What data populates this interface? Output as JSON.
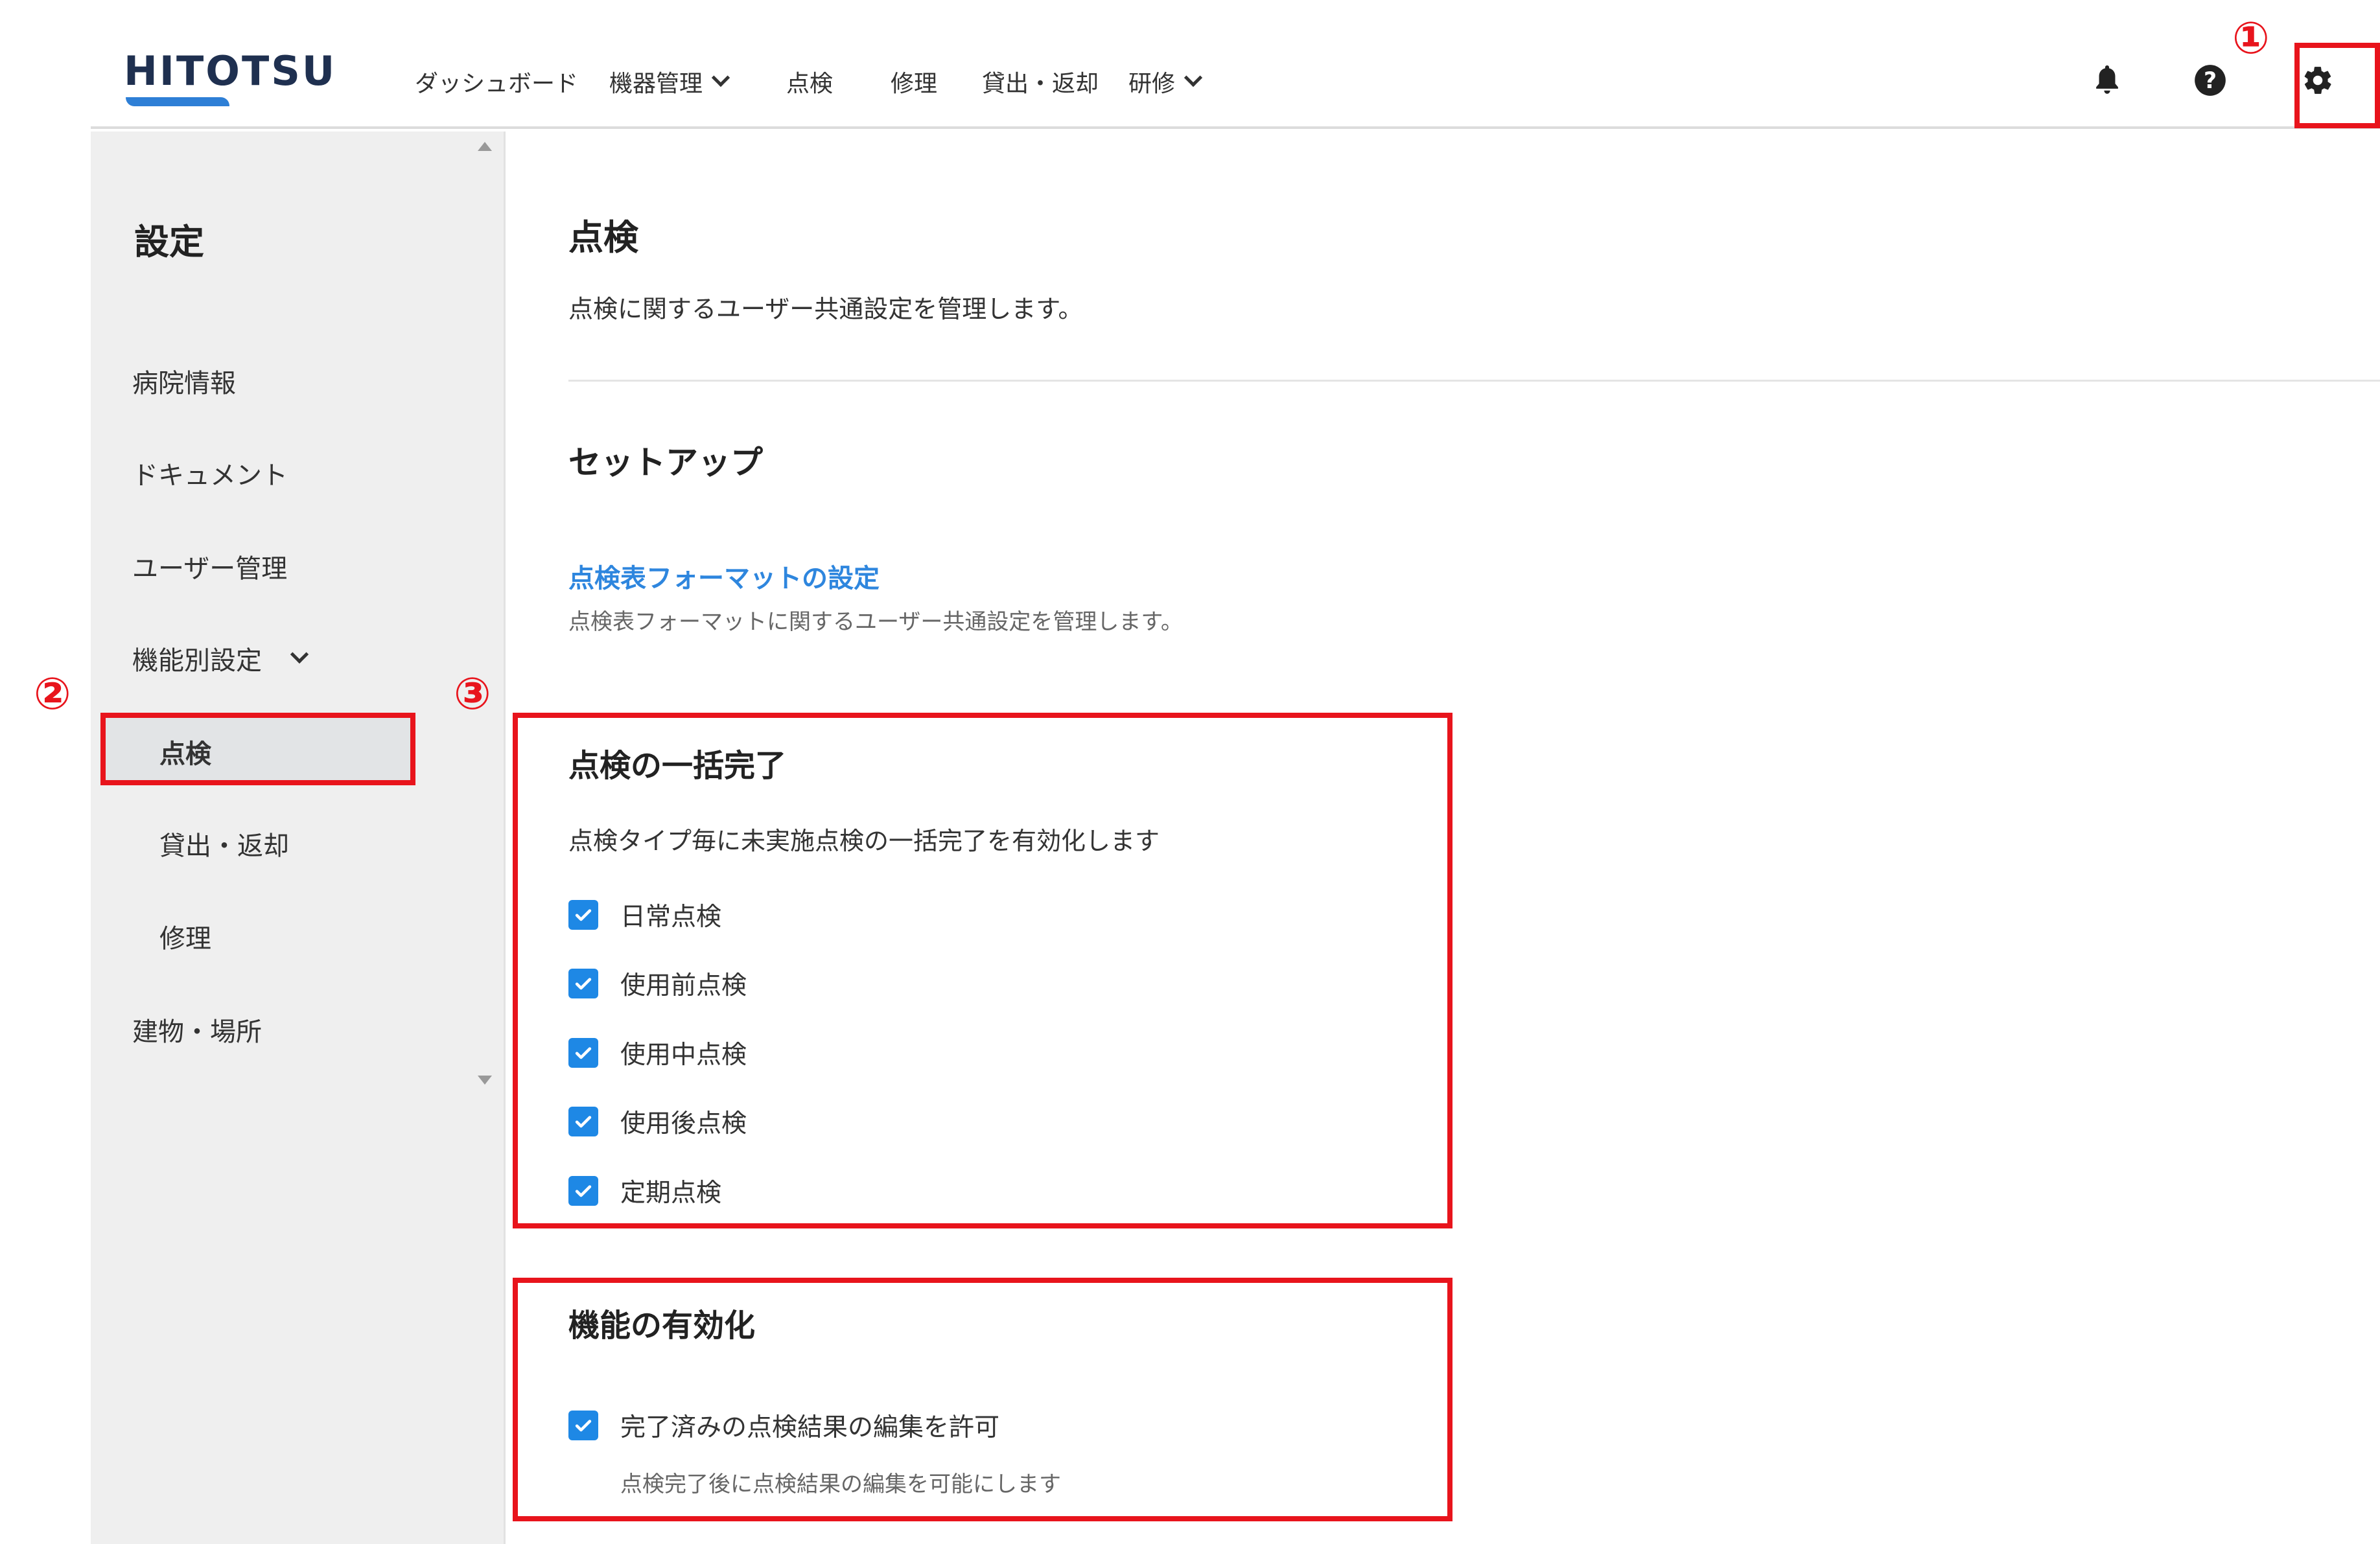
{
  "header": {
    "logo": "HITOTSU",
    "nav": [
      {
        "label": "ダッシュボード",
        "dropdown": false
      },
      {
        "label": "機器管理",
        "dropdown": true
      },
      {
        "label": "点検",
        "dropdown": false
      },
      {
        "label": "修理",
        "dropdown": false
      },
      {
        "label": "貸出・返却",
        "dropdown": false
      },
      {
        "label": "研修",
        "dropdown": true
      }
    ],
    "icons": [
      "bell-icon",
      "help-icon",
      "gear-icon"
    ]
  },
  "sidebar": {
    "title": "設定",
    "items": [
      {
        "label": "病院情報"
      },
      {
        "label": "ドキュメント"
      },
      {
        "label": "ユーザー管理"
      },
      {
        "label": "機能別設定",
        "expanded": true
      },
      {
        "label": "点検",
        "active": true
      },
      {
        "label": "貸出・返却"
      },
      {
        "label": "修理"
      },
      {
        "label": "建物・場所"
      }
    ]
  },
  "main": {
    "title": "点検",
    "description": "点検に関するユーザー共通設定を管理します。",
    "setup": {
      "heading": "セットアップ",
      "link_label": "点検表フォーマットの設定",
      "link_desc": "点検表フォーマットに関するユーザー共通設定を管理します。"
    },
    "bulk": {
      "heading": "点検の一括完了",
      "description": "点検タイプ毎に未実施点検の一括完了を有効化します",
      "options": [
        {
          "label": "日常点検",
          "checked": true
        },
        {
          "label": "使用前点検",
          "checked": true
        },
        {
          "label": "使用中点検",
          "checked": true
        },
        {
          "label": "使用後点検",
          "checked": true
        },
        {
          "label": "定期点検",
          "checked": true
        }
      ]
    },
    "features": {
      "heading": "機能の有効化",
      "option_label": "完了済みの点検結果の編集を許可",
      "option_checked": true,
      "option_hint": "点検完了後に点検結果の編集を可能にします"
    }
  },
  "annotations": {
    "one": "①",
    "two": "②",
    "three": "③",
    "color": "#e8141c"
  },
  "colors": {
    "accent": "#1e88e5",
    "link": "#2e86de",
    "logo": "#1f3050"
  }
}
